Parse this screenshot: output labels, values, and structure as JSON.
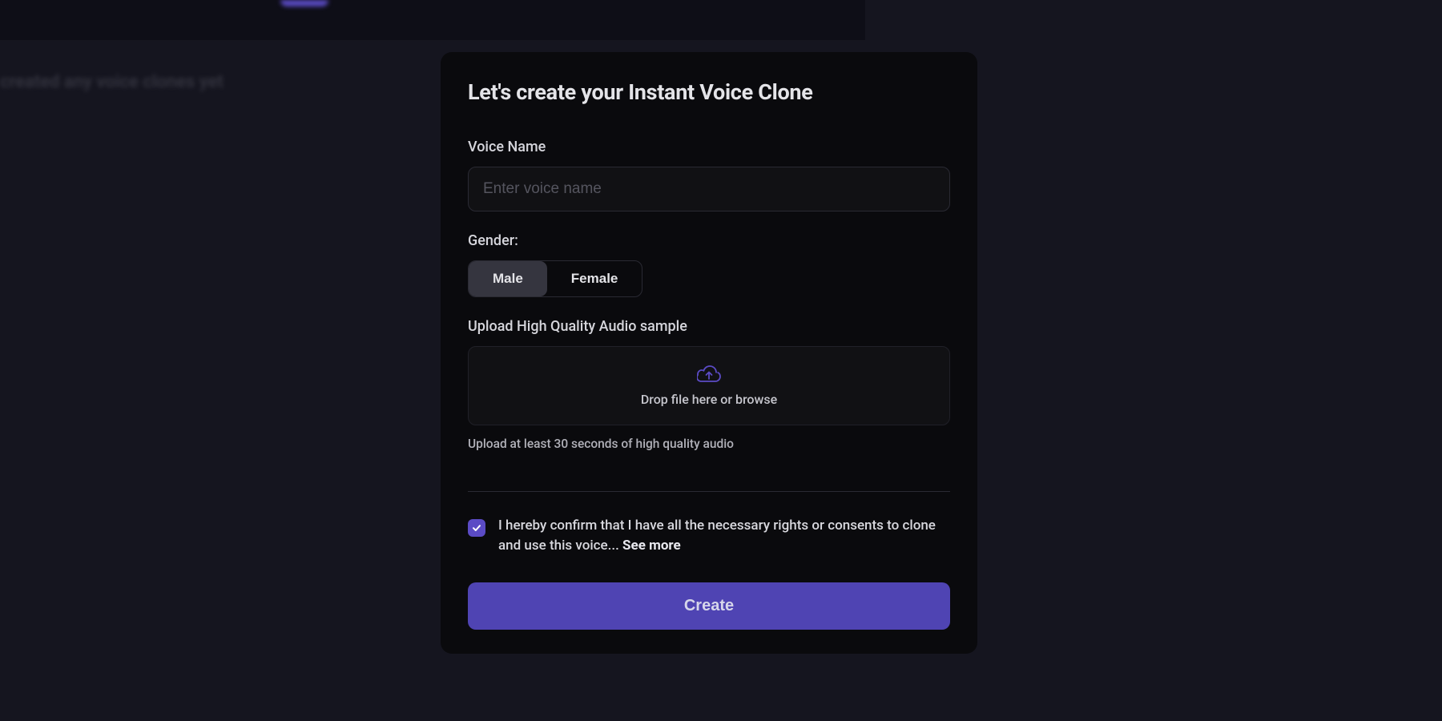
{
  "backdrop": {
    "blurred_text": "created any voice clones yet"
  },
  "modal": {
    "title": "Let's create your Instant Voice Clone",
    "voice_name": {
      "label": "Voice Name",
      "placeholder": "Enter voice name",
      "value": ""
    },
    "gender": {
      "label": "Gender:",
      "options": {
        "male": "Male",
        "female": "Female"
      },
      "selected": "male"
    },
    "upload": {
      "label": "Upload High Quality Audio sample",
      "drop_text": "Drop file here or browse",
      "hint": "Upload at least 30 seconds of high quality audio"
    },
    "consent": {
      "checked": true,
      "text": "I hereby confirm that I have all the necessary rights or consents to clone and use this voice... ",
      "see_more": "See more"
    },
    "create_label": "Create"
  },
  "colors": {
    "accent": "#5b4bc5"
  }
}
